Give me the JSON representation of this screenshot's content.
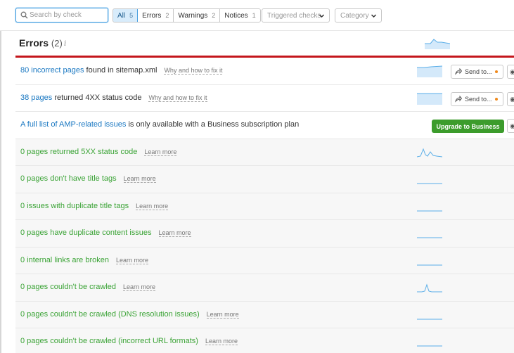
{
  "search": {
    "placeholder": "Search by check"
  },
  "filters": [
    {
      "label": "All",
      "count": "5",
      "active": true
    },
    {
      "label": "Errors",
      "count": "2",
      "active": false
    },
    {
      "label": "Warnings",
      "count": "2",
      "active": false
    },
    {
      "label": "Notices",
      "count": "1",
      "active": false
    }
  ],
  "dropdowns": {
    "triggered": "Triggered checks",
    "category": "Category"
  },
  "section": {
    "title": "Errors",
    "count": "(2)",
    "info_icon": "i"
  },
  "rows": [
    {
      "link": "80 incorrect pages",
      "rest": " found in sitemap.xml",
      "how": "Why and how to fix it",
      "send": "Send to...",
      "eye": "◉"
    },
    {
      "link": "38 pages",
      "rest": " returned 4XX status code",
      "how": "Why and how to fix it",
      "send": "Send to...",
      "eye": "◉"
    },
    {
      "link": "A full list of AMP-related issues",
      "rest": " is only available with a Business subscription plan",
      "upgrade": "Upgrade to Business",
      "eye": "◉"
    },
    {
      "ok": "0 pages returned 5XX status code",
      "how": "Learn more"
    },
    {
      "ok": "0 pages don't have title tags",
      "how": "Learn more"
    },
    {
      "ok": "0 issues with duplicate title tags",
      "how": "Learn more"
    },
    {
      "ok": "0 pages have duplicate content issues",
      "how": "Learn more"
    },
    {
      "ok": "0 internal links are broken",
      "how": "Learn more"
    },
    {
      "ok": "0 pages couldn't be crawled",
      "how": "Learn more"
    },
    {
      "ok": "0 pages couldn't be crawled (DNS resolution issues)",
      "how": "Learn more"
    },
    {
      "ok": "0 pages couldn't be crawled (incorrect URL formats)",
      "how": "Learn more"
    }
  ],
  "colors": {
    "accent": "#1a78c2",
    "ok": "#3aa335",
    "error_bar": "#c4161c",
    "upgrade": "#3c9c2c",
    "spark": "#5aaee8"
  }
}
